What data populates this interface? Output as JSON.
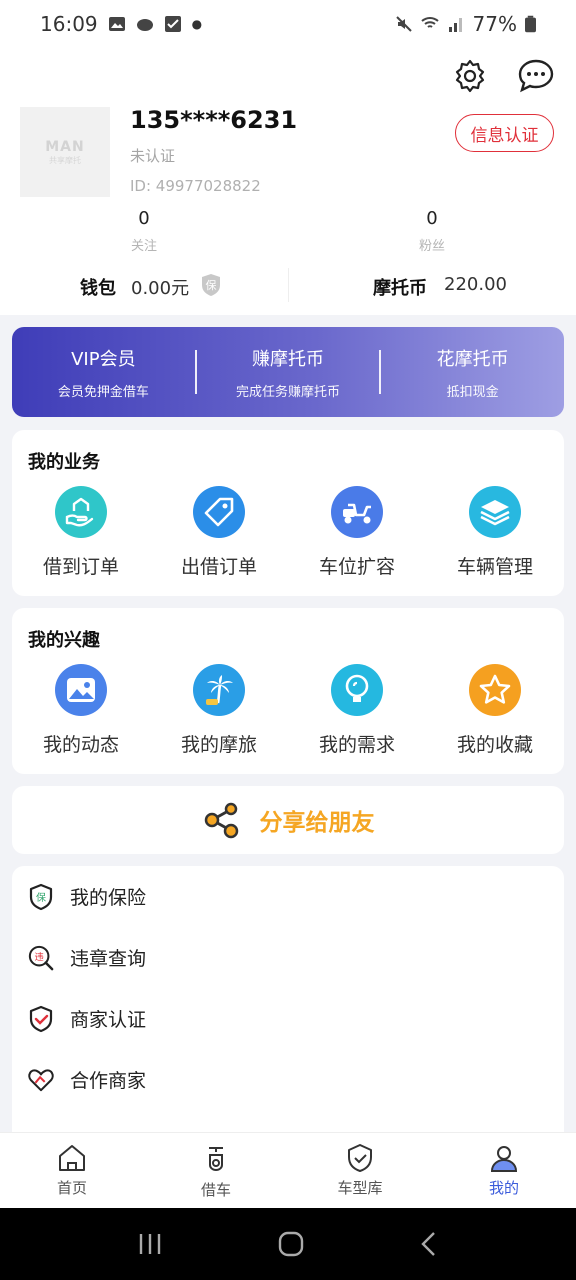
{
  "status_bar": {
    "time": "16:09",
    "battery": "77%"
  },
  "profile": {
    "avatar_line1": "MAN",
    "avatar_line2": "共享摩托",
    "phone": "135****6231",
    "status": "未认证",
    "id": "ID: 49977028822",
    "verify_button": "信息认证",
    "follow_count": "0",
    "follow_label": "关注",
    "fans_count": "0",
    "fans_label": "粉丝"
  },
  "wallet": {
    "wallet_label": "钱包",
    "wallet_value": "0.00元",
    "badge": "保",
    "coin_label": "摩托币",
    "coin_value": "220.00"
  },
  "vip_banner": [
    {
      "title": "VIP会员",
      "subtitle": "会员免押金借车"
    },
    {
      "title": "赚摩托币",
      "subtitle": "完成任务赚摩托币"
    },
    {
      "title": "花摩托币",
      "subtitle": "抵扣现金"
    }
  ],
  "business": {
    "title": "我的业务",
    "items": [
      {
        "label": "借到订单",
        "icon": "hand-house-icon",
        "color": "#2fc6c9"
      },
      {
        "label": "出借订单",
        "icon": "tag-icon",
        "color": "#2b8ee8"
      },
      {
        "label": "车位扩容",
        "icon": "scooter-icon",
        "color": "#4a7be8"
      },
      {
        "label": "车辆管理",
        "icon": "layers-icon",
        "color": "#28b8e0"
      }
    ]
  },
  "interests": {
    "title": "我的兴趣",
    "items": [
      {
        "label": "我的动态",
        "icon": "image-icon",
        "color": "#4a82ea"
      },
      {
        "label": "我的摩旅",
        "icon": "palm-tree-icon",
        "color": "#2a9ee6"
      },
      {
        "label": "我的需求",
        "icon": "bulb-icon",
        "color": "#25b8e0"
      },
      {
        "label": "我的收藏",
        "icon": "star-icon",
        "color": "#f5a020"
      }
    ]
  },
  "share": {
    "label": "分享给朋友"
  },
  "menu": [
    {
      "label": "我的保险",
      "icon": "insurance-shield-icon",
      "glyph": "保"
    },
    {
      "label": "违章查询",
      "icon": "violation-search-icon",
      "glyph": "违"
    },
    {
      "label": "商家认证",
      "icon": "merchant-verify-icon",
      "glyph": ""
    },
    {
      "label": "合作商家",
      "icon": "partner-heart-icon",
      "glyph": ""
    }
  ],
  "tabs": [
    {
      "label": "首页",
      "icon": "home-icon"
    },
    {
      "label": "借车",
      "icon": "rent-scooter-icon"
    },
    {
      "label": "车型库",
      "icon": "model-library-icon"
    },
    {
      "label": "我的",
      "icon": "profile-icon",
      "active": true
    }
  ],
  "colors": {
    "accent": "#3b5bdb",
    "danger": "#e0303a",
    "gold": "#f5a623"
  }
}
